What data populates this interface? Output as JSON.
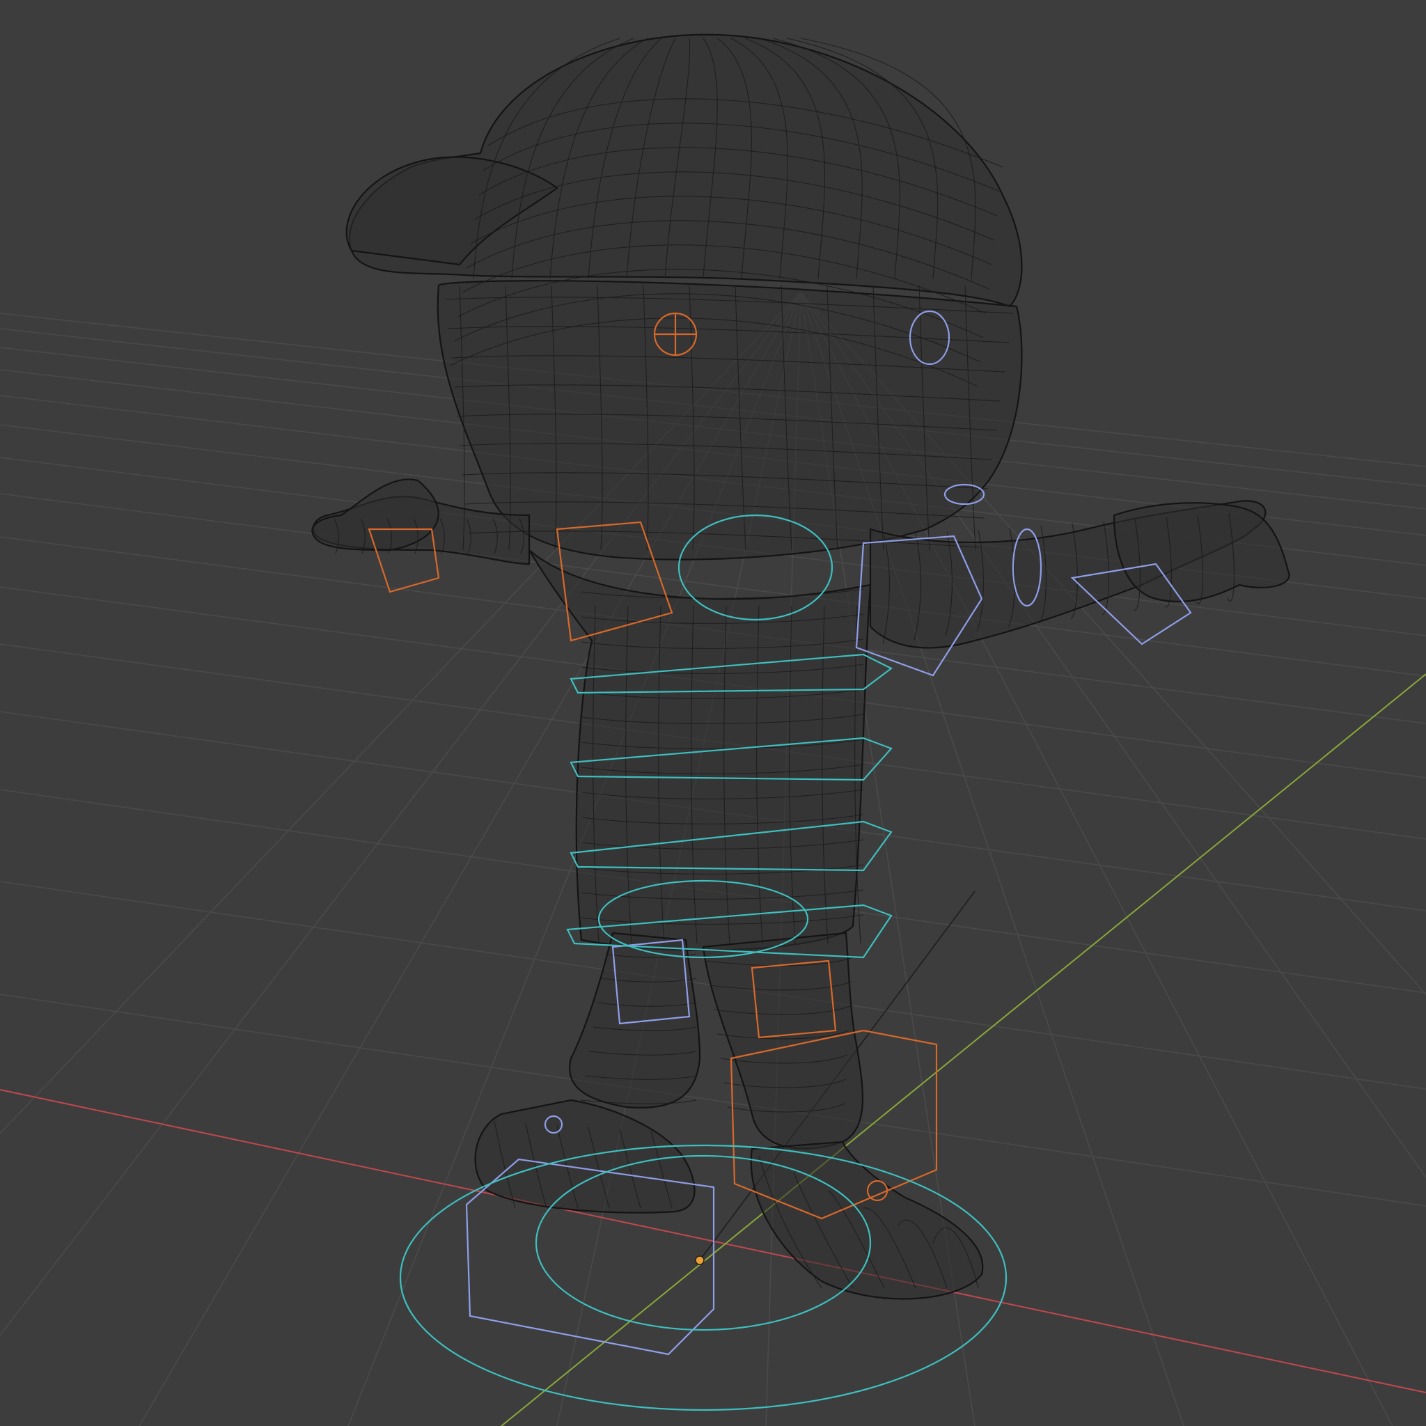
{
  "viewport": {
    "mode": "wireframe",
    "background": "#3d3d3d",
    "grid_color": "#4a4a4a",
    "axis_colors": {
      "x": "#c0484f",
      "y": "#8aa83a",
      "z": "#222222"
    },
    "mesh_color": "#141414",
    "widget_colors": {
      "left_side": "#d8692a",
      "right_side": "#8f9ee8",
      "center": "#3fbfbf"
    },
    "grid_rows": [
      450,
      470,
      495,
      525,
      560,
      600,
      645,
      695,
      755,
      825,
      905,
      1000,
      1110,
      1240,
      1400
    ],
    "grid_cols": [
      -400,
      -100,
      200,
      500,
      800,
      1100,
      1400,
      1700,
      2000,
      2300,
      2600
    ]
  },
  "scene": {
    "object": "character-mesh",
    "rig": "armature-controls"
  }
}
